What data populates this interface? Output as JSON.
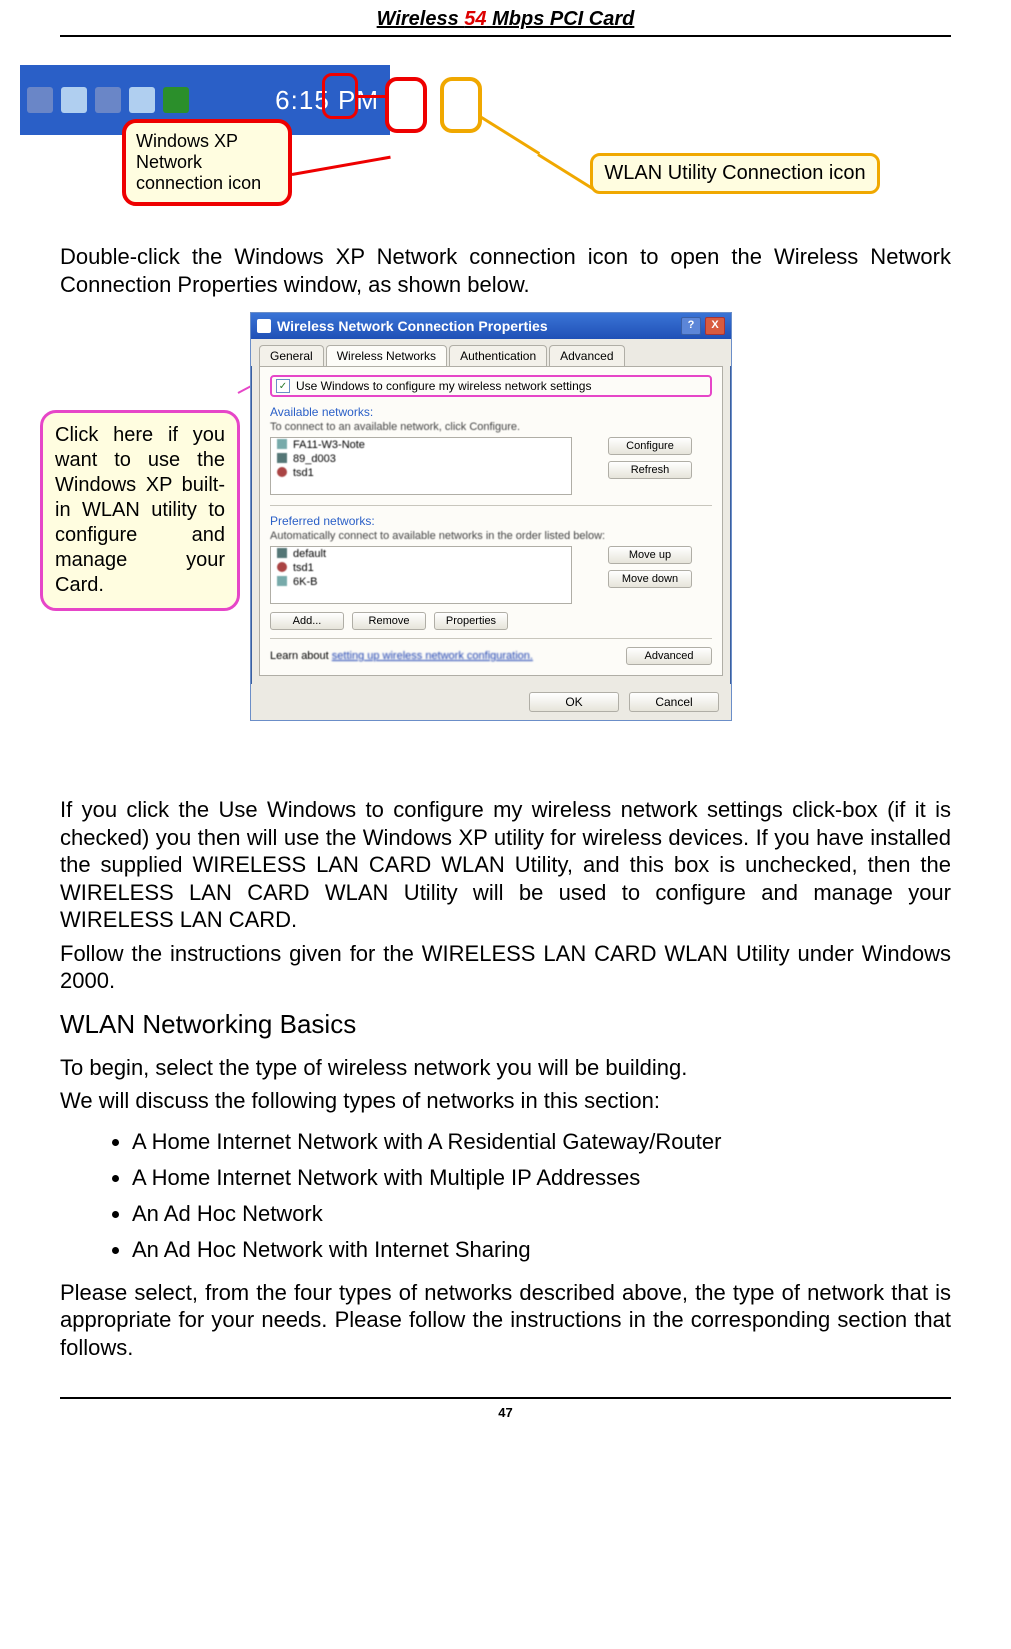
{
  "header": {
    "prefix": "Wireless ",
    "red": "54",
    "suffix": " Mbps PCI Card"
  },
  "systray": {
    "clock": "6:15 PM"
  },
  "callouts": {
    "xp_icon": "Windows XP Network connection icon",
    "wlan_icon": "WLAN Utility Connection icon",
    "pink": "Click here if you want to use the Windows XP built-in WLAN utility to configure and manage your Card."
  },
  "paragraphs": {
    "p1": "Double-click the Windows XP Network connection icon to open the Wireless Network Connection Properties window, as shown below.",
    "p2": "If you click the Use Windows to configure my wireless network settings click-box (if it is checked) you then will use the Windows XP utility for wireless devices.   If you have installed the supplied WIRELESS LAN CARD WLAN Utility, and this box is unchecked, then the WIRELESS LAN CARD WLAN Utility will be used to configure and manage your WIRELESS LAN CARD.",
    "p3": "Follow the instructions given for the WIRELESS LAN CARD WLAN Utility under Windows 2000.",
    "p4": "To begin, select the type of wireless network you will be building.",
    "p5": "We will discuss the following types of networks in this section:",
    "p6": "Please select, from the four types of networks described above, the type of network that is appropriate for your needs. Please follow the instructions in the corresponding section that follows."
  },
  "section_heading": "WLAN Networking Basics",
  "bullets": [
    "A Home Internet Network with A Residential Gateway/Router",
    "A Home Internet Network with Multiple IP Addresses",
    "An Ad Hoc Network",
    "An Ad Hoc Network with Internet Sharing"
  ],
  "dialog": {
    "title": "Wireless Network Connection Properties",
    "help_btn": "?",
    "close_btn": "X",
    "tabs": [
      "General",
      "Wireless Networks",
      "Authentication",
      "Advanced"
    ],
    "checkbox_label": "Use Windows to configure my wireless network settings",
    "checkmark": "✓",
    "available_label": "Available networks:",
    "available_hint": "To connect to an available network, click Configure.",
    "available_items": [
      "FA11-W3-Note",
      "89_d003",
      "tsd1"
    ],
    "configure_btn": "Configure",
    "refresh_btn": "Refresh",
    "preferred_label": "Preferred networks:",
    "preferred_hint": "Automatically connect to available networks in the order listed below:",
    "preferred_items": [
      "default",
      "tsd1",
      "6K-B"
    ],
    "moveup_btn": "Move up",
    "movedown_btn": "Move down",
    "add_btn": "Add...",
    "remove_btn": "Remove",
    "properties_btn": "Properties",
    "learn_prefix": "Learn about ",
    "learn_link": "setting up wireless network configuration.",
    "advanced_btn": "Advanced",
    "ok_btn": "OK",
    "cancel_btn": "Cancel"
  },
  "page_number": "47"
}
